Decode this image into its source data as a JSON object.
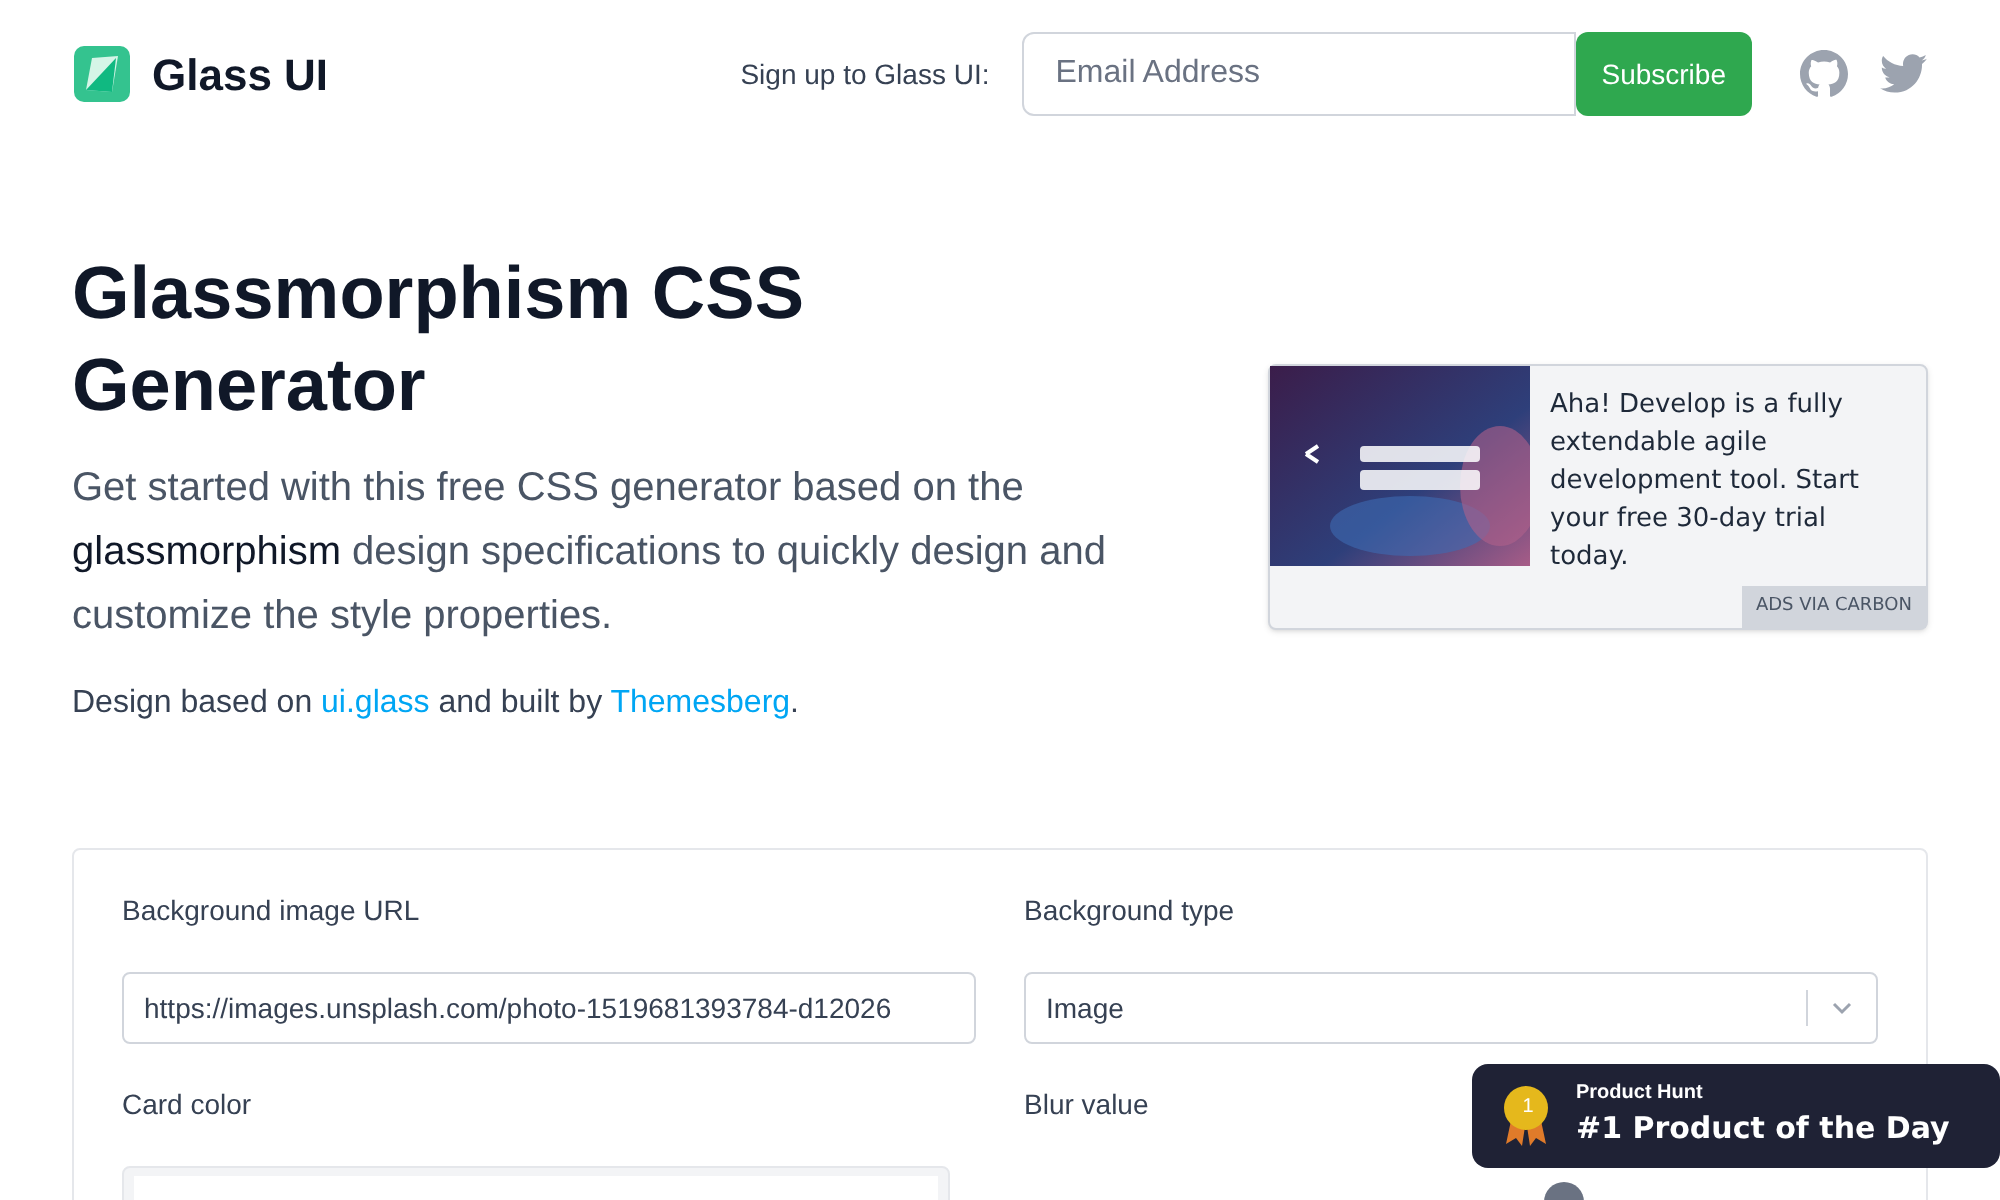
{
  "header": {
    "logo": "Glass UI",
    "signup_label": "Sign up to Glass UI:",
    "email_placeholder": "Email Address",
    "subscribe": "Subscribe"
  },
  "hero": {
    "title": "Glassmorphism CSS Generator",
    "description": "Get started with this free CSS generator based on the **glassmorphism** design specifications to quickly design and customize the style properties.",
    "credit": [
      {
        "kind": "text",
        "text": "Design based on "
      },
      {
        "kind": "link",
        "text": "ui.glass"
      },
      {
        "kind": "text",
        "text": " and built by "
      },
      {
        "kind": "link",
        "text": "Themesberg"
      },
      {
        "kind": "text",
        "text": "."
      }
    ]
  },
  "ad": {
    "text": "Aha! Develop is a fully extendable agile development tool. Start your free 30-day trial today.",
    "label": "ADS VIA CARBON"
  },
  "form": {
    "fields": [
      {
        "kind": "text",
        "label": "Background image URL",
        "value": "https://images.unsplash.com/photo-1519681393784-d12026"
      },
      {
        "kind": "select",
        "label": "Background type",
        "value": "Image"
      },
      {
        "kind": "color",
        "label": "Card color"
      },
      {
        "kind": "slider",
        "label": "Blur value"
      }
    ]
  },
  "badge": {
    "overline": "Product Hunt",
    "title": "#1 Product of the Day",
    "rank": "1"
  }
}
